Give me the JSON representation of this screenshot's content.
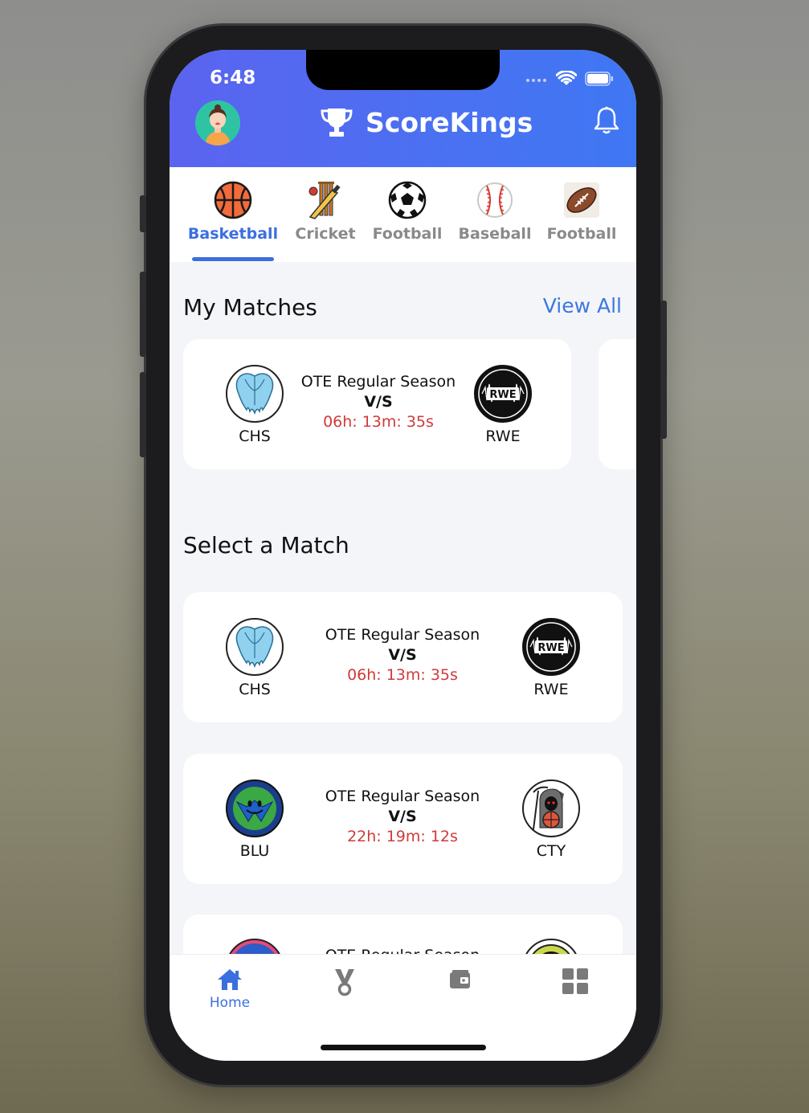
{
  "status_bar": {
    "time": "6:48"
  },
  "header": {
    "app_title": "ScoreKings",
    "brand_color": "#4a6ff2"
  },
  "sport_tabs": [
    {
      "label": "Basketball",
      "icon": "basketball-icon",
      "active": true
    },
    {
      "label": "Cricket",
      "icon": "cricket-icon",
      "active": false
    },
    {
      "label": "Football",
      "icon": "soccer-ball-icon",
      "active": false
    },
    {
      "label": "Baseball",
      "icon": "baseball-icon",
      "active": false
    },
    {
      "label": "Football",
      "icon": "american-football-icon",
      "active": false
    }
  ],
  "my_matches": {
    "title": "My Matches",
    "view_all": "View All",
    "items": [
      {
        "home": "CHS",
        "away": "RWE",
        "season": "OTE Regular Season",
        "vs": "V/S",
        "countdown": "06h: 13m: 35s"
      }
    ]
  },
  "select_match": {
    "title": "Select a Match",
    "items": [
      {
        "home": "CHS",
        "away": "RWE",
        "season": "OTE Regular Season",
        "vs": "V/S",
        "countdown": "06h: 13m: 35s"
      },
      {
        "home": "BLU",
        "away": "CTY",
        "season": "OTE Regular Season",
        "vs": "V/S",
        "countdown": "22h: 19m: 12s"
      },
      {
        "season": "OTE Regular Season"
      }
    ]
  },
  "bottom_nav": [
    {
      "label": "Home",
      "icon": "home-icon",
      "active": true
    },
    {
      "label": "",
      "icon": "medal-icon",
      "active": false
    },
    {
      "label": "",
      "icon": "wallet-icon",
      "active": false
    },
    {
      "label": "",
      "icon": "grid-icon",
      "active": false
    }
  ],
  "colors": {
    "accent": "#3b6fe0",
    "countdown": "#d13a3a",
    "countdown_text": "#d13a3a"
  }
}
